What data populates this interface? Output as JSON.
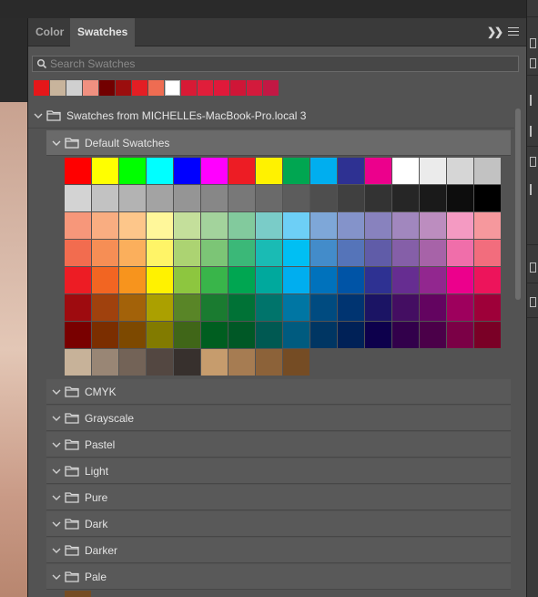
{
  "tabs": [
    {
      "label": "Color",
      "active": false
    },
    {
      "label": "Swatches",
      "active": true
    }
  ],
  "search": {
    "placeholder": "Search Swatches",
    "value": ""
  },
  "recent_swatches": [
    "#e5171a",
    "#c8b49c",
    "#d0d0d0",
    "#f09080",
    "#720000",
    "#9b0e0e",
    "#e31e24",
    "#ee6c52",
    "#ffffff",
    "#d71a35",
    "#e01e3a",
    "#e0193a",
    "#cf1637",
    "#d31a3c",
    "#c21844"
  ],
  "groups": {
    "root": {
      "label": "Swatches from MICHELLEs-MacBook-Pro.local 3"
    },
    "default": {
      "label": "Default Swatches"
    },
    "others": [
      "CMYK",
      "Grayscale",
      "Pastel",
      "Light",
      "Pure",
      "Dark",
      "Darker",
      "Pale"
    ]
  },
  "default_swatches": [
    [
      "#ff0000",
      "#ffff00",
      "#00ff00",
      "#00ffff",
      "#0000ff",
      "#ff00ff",
      "#ed1c24",
      "#fff200",
      "#00a651",
      "#00aeef",
      "#2e3192",
      "#ec008c",
      "#ffffff",
      "#ebebeb",
      "#d6d6d6",
      "#c2c2c2"
    ],
    [
      "#d3d3d3",
      "#c2c2c2",
      "#b3b3b3",
      "#a3a3a3",
      "#959595",
      "#878787",
      "#787878",
      "#6a6a6a",
      "#5c5c5c",
      "#4e4e4e",
      "#404040",
      "#333333",
      "#262626",
      "#1a1a1a",
      "#0d0d0d",
      "#000000"
    ],
    [
      "#f7977a",
      "#f9ad81",
      "#fdc68a",
      "#fff79a",
      "#c4df9b",
      "#a3d39c",
      "#82ca9d",
      "#7accc8",
      "#6dcff6",
      "#7ea7d8",
      "#8493ca",
      "#8882be",
      "#a187be",
      "#bc8dbf",
      "#f49ac2",
      "#f6989d"
    ],
    [
      "#f26c4f",
      "#f68e55",
      "#fbaf5c",
      "#fff467",
      "#acd372",
      "#7cc576",
      "#3bb878",
      "#1abbb4",
      "#00bff3",
      "#438cca",
      "#5574b9",
      "#605ca8",
      "#855fa8",
      "#a763a8",
      "#f06eaa",
      "#f26d7d"
    ],
    [
      "#ed1c24",
      "#f26522",
      "#f7941d",
      "#fff200",
      "#8dc63f",
      "#39b54a",
      "#00a651",
      "#00a99d",
      "#00aeef",
      "#0072bc",
      "#0054a6",
      "#2e3192",
      "#662d91",
      "#92278f",
      "#ec008c",
      "#ed145b"
    ],
    [
      "#9e0b0f",
      "#a0410d",
      "#a36209",
      "#aba000",
      "#598527",
      "#1a7b30",
      "#007236",
      "#00746b",
      "#0076a3",
      "#004b80",
      "#003471",
      "#1b1464",
      "#440e62",
      "#630460",
      "#9e005d",
      "#9e0039"
    ],
    [
      "#790000",
      "#7b2e00",
      "#7d4900",
      "#827b00",
      "#406618",
      "#005e20",
      "#005826",
      "#005952",
      "#005b7f",
      "#003663",
      "#002157",
      "#0d004c",
      "#32004b",
      "#4b0049",
      "#7b0046",
      "#7a0026"
    ],
    [
      "#c7b299",
      "#998675",
      "#736357",
      "#534741",
      "#37302d",
      "#c69c6d",
      "#a67c52",
      "#8c6239",
      "#754c24"
    ]
  ],
  "default_swatches_row1_override": [
    [
      "#ff0000",
      "#ffff00",
      "#00ff00",
      "#00ffff",
      "#0000ff",
      "#ff00ff",
      "#ed1c24",
      "#fff200",
      "#00a651",
      "#00aeef",
      "#2e3192",
      "#ec008c",
      "#ffffff",
      "#ebebeb",
      "#d6d6d6",
      "#c2c2c2"
    ]
  ],
  "pale_preview_color": "#754c24",
  "colors": {
    "panel": "#535353",
    "tabbar": "#3a3a3a",
    "selected_row": "#6a6a6a"
  }
}
